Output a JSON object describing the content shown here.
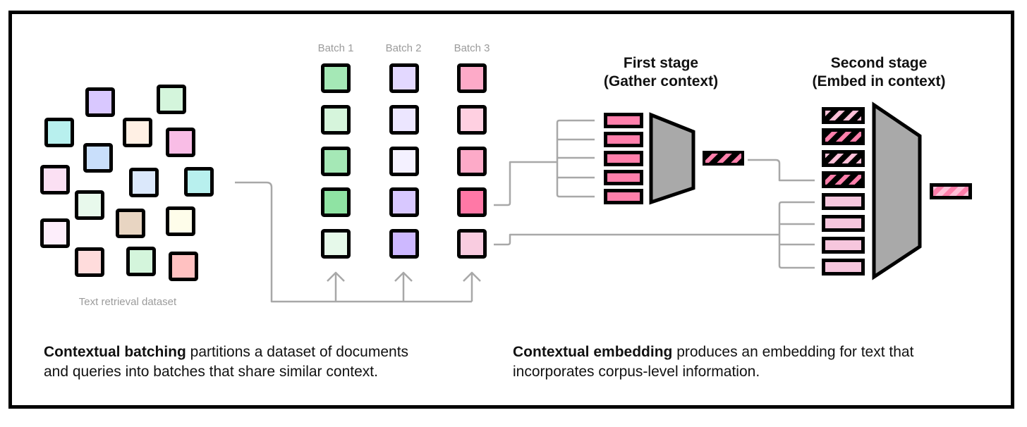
{
  "dataset": {
    "label": "Text retrieval dataset",
    "square_colors": [
      "#d9c8ff",
      "#d4f5dc",
      "#b8f0ee",
      "#fff0e4",
      "#f9bde6",
      "#c9dffb",
      "#fbe0f3",
      "#dbe8fb",
      "#b8f0ee",
      "#e8f9ec",
      "#e8d5c2",
      "#fefdea",
      "#fdeefb",
      "#ffdcdc",
      "#d4f5dc",
      "#ffc1c1"
    ]
  },
  "batches": [
    {
      "label": "Batch 1",
      "colors": [
        "#a5e8b6",
        "#d6f5dc",
        "#a5e8b6",
        "#8fe3a3",
        "#e6f9ea"
      ]
    },
    {
      "label": "Batch 2",
      "colors": [
        "#e3d8ff",
        "#ece6ff",
        "#f4f1ff",
        "#d8c8ff",
        "#cdb8ff"
      ]
    },
    {
      "label": "Batch 3",
      "colors": [
        "#fdaac8",
        "#ffd0e1",
        "#fdaac8",
        "#ff78a6",
        "#f9cce0"
      ]
    }
  ],
  "first_stage": {
    "title_line1": "First stage",
    "title_line2": "(Gather context)",
    "input_count": 5,
    "input_color": "#ff7fab",
    "output_type": "hatched context embedding"
  },
  "second_stage": {
    "title_line1": "Second stage",
    "title_line2": "(Embed in context)",
    "context_count": 4,
    "doc_count": 4,
    "doc_color": "#f6c6dd",
    "output_type": "hatched contextual embedding"
  },
  "colors": {
    "encoder_fill": "#a9a9a9",
    "connector": "#a8a8a8",
    "hatch_dark": "#ff7fab",
    "hatch_light": "#ffc0d8"
  },
  "captions": {
    "left_bold": "Contextual batching",
    "left_rest_line1": " partitions a dataset of documents",
    "left_line2": "and queries into batches that share similar context.",
    "right_bold": "Contextual embedding",
    "right_rest_line1": " produces an embedding for text that",
    "right_line2": "incorporates corpus-level information."
  }
}
